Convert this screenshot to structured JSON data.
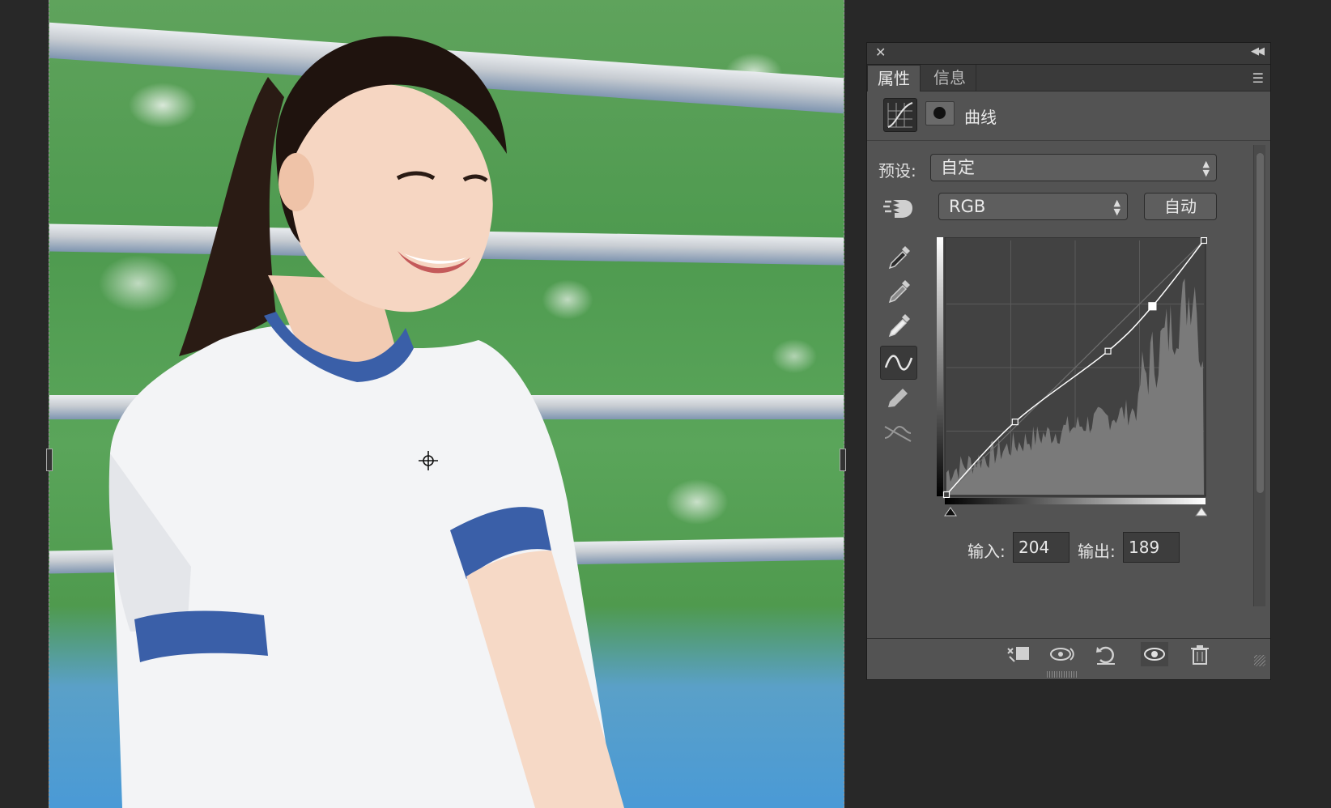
{
  "panel": {
    "tabs": [
      {
        "label": "属性"
      },
      {
        "label": "信息"
      }
    ],
    "title": "曲线",
    "preset": {
      "label": "预设:",
      "value": "自定"
    },
    "channel": {
      "value": "RGB"
    },
    "auto_label": "自动",
    "input_label": "输入:",
    "input_value": "204",
    "output_label": "输出:",
    "output_value": "189"
  },
  "curve": {
    "points": [
      [
        0,
        0
      ],
      [
        68,
        73
      ],
      [
        160,
        144
      ],
      [
        204,
        189
      ],
      [
        255,
        255
      ]
    ],
    "selected_point": [
      204,
      189
    ]
  },
  "icons": {
    "close": "close-icon",
    "collapse": "collapse-icon",
    "panel_menu": "panel-menu-icon",
    "curves_adjustment": "curves-adjustment-icon",
    "layer_mask": "layer-mask-icon",
    "on_image_adjust": "targeted-adjustment-hand-icon",
    "black_eyedropper": "eyedropper-black-icon",
    "gray_eyedropper": "eyedropper-gray-icon",
    "white_eyedropper": "eyedropper-white-icon",
    "curve_edit": "curve-edit-icon",
    "pencil": "pencil-draw-icon",
    "smooth": "smooth-curve-icon",
    "clip_layer": "clip-to-layer-icon",
    "view_previous": "view-previous-state-icon",
    "reset": "reset-icon",
    "visibility": "eye-icon",
    "delete": "trash-icon"
  },
  "colors": {
    "panel_bg": "#535353",
    "graph_bg": "#424242",
    "histogram": "#7a7a7a",
    "curve": "#ffffff"
  }
}
